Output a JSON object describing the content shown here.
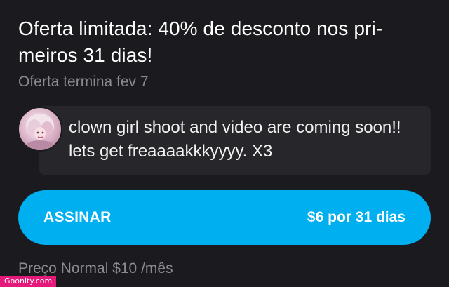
{
  "offer": {
    "title": "Oferta limitada: 40% de desconto nos pri-meiros 31 dias!",
    "ends": "Oferta termina fev 7"
  },
  "message": {
    "avatar_icon": "avatar-photo",
    "text": "clown girl shoot and video are coming soon!! lets get freaaaakkkyyyy. X3"
  },
  "subscribe": {
    "label": "ASSINAR",
    "price": "$6 por 31 dias",
    "color": "#00aff0"
  },
  "regular_price": "Preço Normal $10 /mês",
  "watermark": "Goonity.com",
  "colors": {
    "background": "#1b1b1f",
    "message_bg": "#26262b",
    "muted_text": "#8a8a8f",
    "watermark_bg": "#e5197a"
  }
}
